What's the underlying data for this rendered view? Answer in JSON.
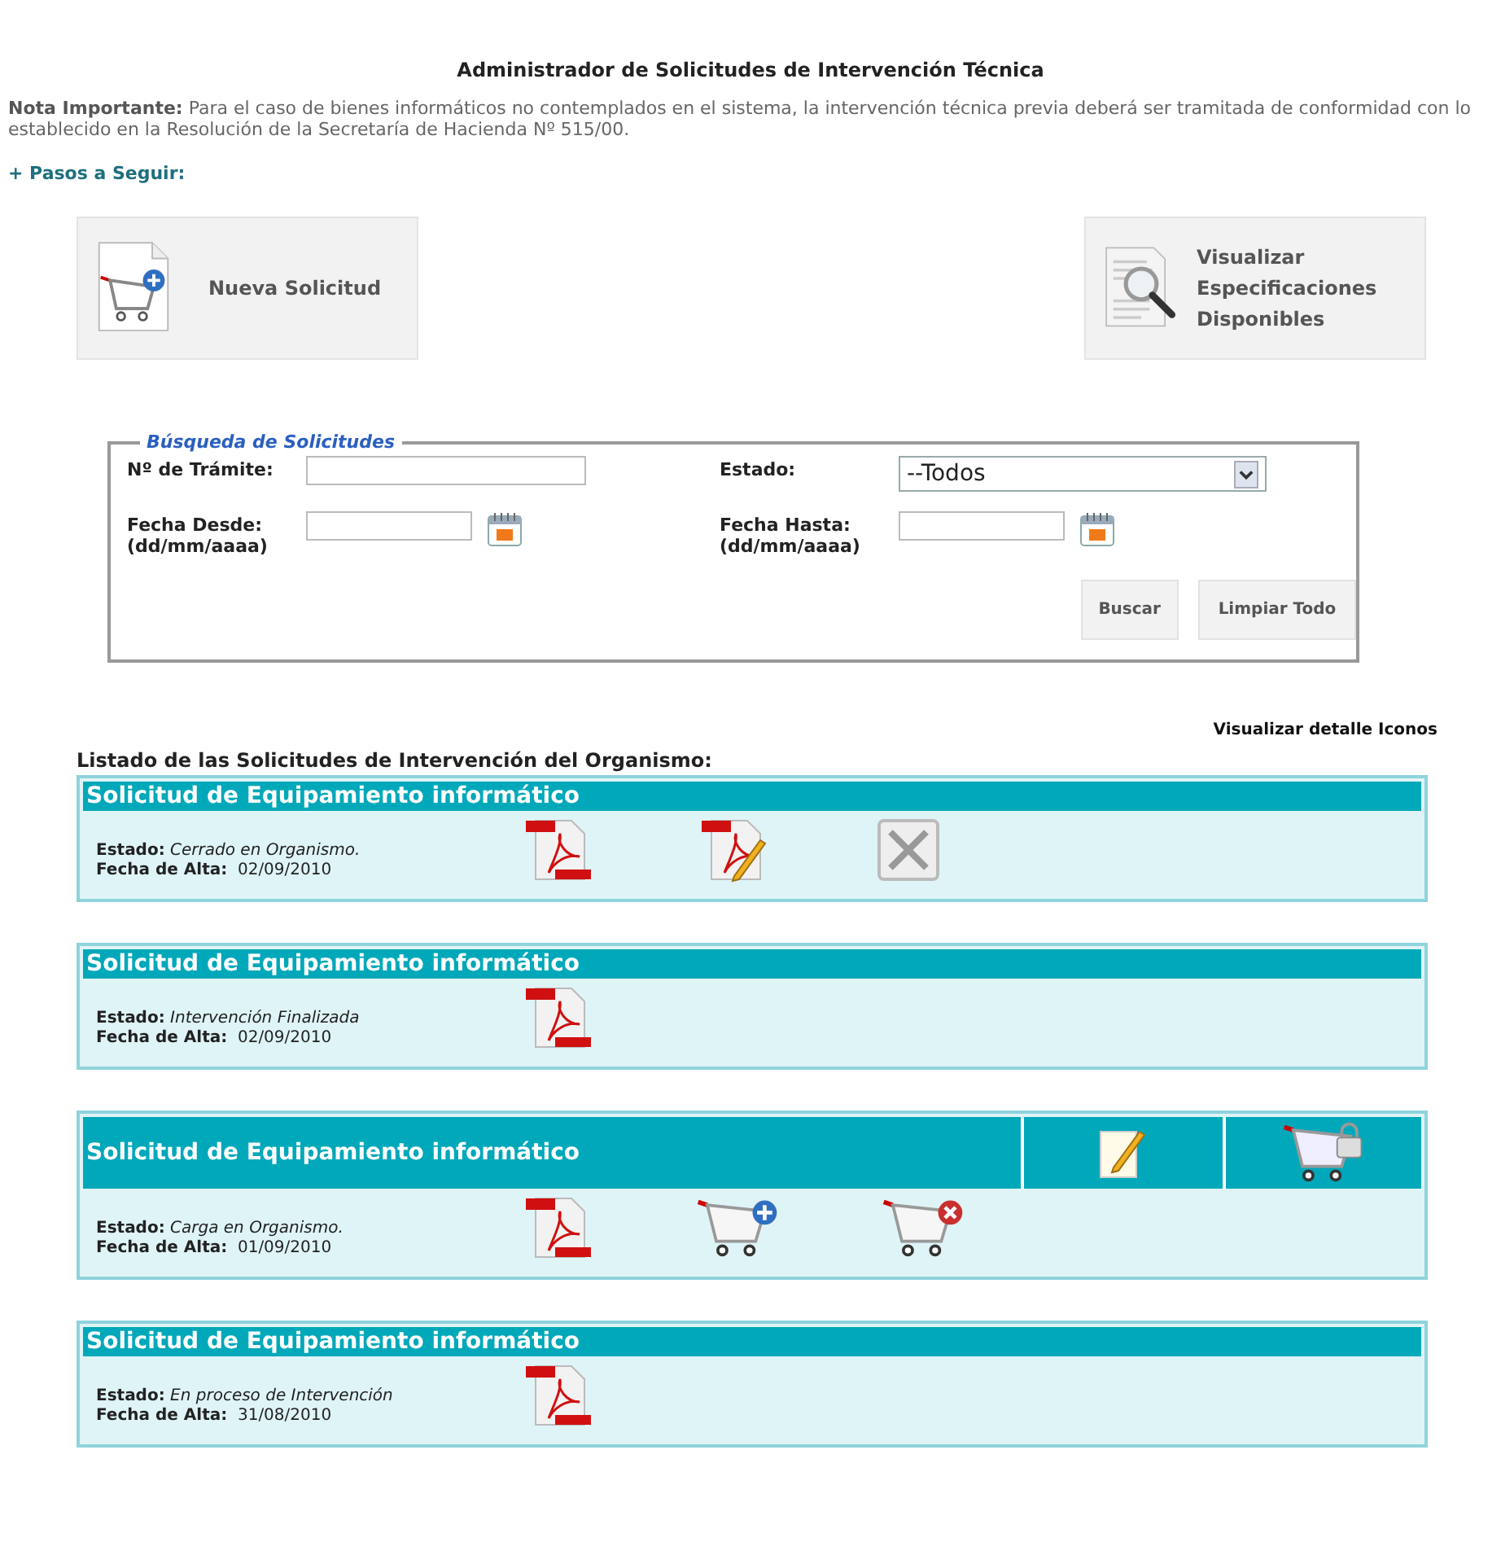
{
  "title": "Administrador de Solicitudes de Intervención Técnica",
  "note": "**Nota Importante:** Para el caso de bienes informáticos no contemplados en el sistema, la intervención técnica previa deberá ser tramitada de conformidad con lo establecido en la Resolución de la Secretaría de Hacienda Nº 515/00.",
  "steps_link": "+ Pasos a Seguir:",
  "big_buttons": [
    {
      "kind": "new-request",
      "label": "Nueva Solicitud"
    },
    {
      "kind": "specs",
      "label": "Visualizar Especificaciones Disponibles"
    }
  ],
  "search": {
    "legend": "Búsqueda de Solicitudes",
    "tramite_label": "Nº de Trámite:",
    "estado_label": "Estado:",
    "estado_value": "--Todos",
    "desde_label": "Fecha Desde:\n(dd/mm/aaaa)",
    "hasta_label": "Fecha Hasta:\n(dd/mm/aaaa)",
    "buttons": [
      "Buscar",
      "Limpiar Todo"
    ]
  },
  "icons_link": "Visualizar detalle Iconos",
  "list_title": "Listado de las Solicitudes de Intervención del Organismo:",
  "requests": [
    {
      "title": "Solicitud de Equipamiento informático",
      "estado_label": "Estado:",
      "estado": "Cerrado en Organismo.",
      "fecha_label": "Fecha de Alta:",
      "fecha": "02/09/2010",
      "actions": [
        {
          "kind": "pdf"
        },
        {
          "kind": "pdf-edit"
        },
        {
          "kind": "cancel"
        }
      ]
    },
    {
      "title": "Solicitud de Equipamiento informático",
      "estado_label": "Estado:",
      "estado": "Intervención Finalizada",
      "fecha_label": "Fecha de Alta:",
      "fecha": "02/09/2010",
      "actions": [
        {
          "kind": "pdf"
        }
      ]
    },
    {
      "title": "Solicitud de Equipamiento informático",
      "estado_label": "Estado:",
      "estado": "Carga en Organismo.",
      "fecha_label": "Fecha de Alta:",
      "fecha": "01/09/2010",
      "header_actions": [
        {
          "kind": "edit"
        },
        {
          "kind": "cart-lock"
        }
      ],
      "actions": [
        {
          "kind": "pdf"
        },
        {
          "kind": "cart-add"
        },
        {
          "kind": "cart-remove"
        }
      ]
    },
    {
      "title": "Solicitud de Equipamiento informático",
      "estado_label": "Estado:",
      "estado": "En proceso de Intervención",
      "fecha_label": "Fecha de Alta:",
      "fecha": "31/08/2010",
      "actions": [
        {
          "kind": "pdf"
        }
      ]
    }
  ]
}
